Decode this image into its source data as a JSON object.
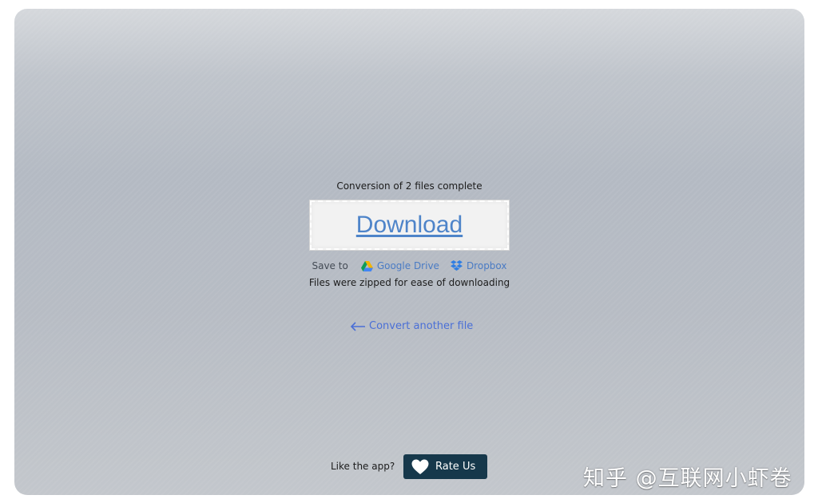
{
  "status": {
    "conversion_text": "Conversion of 2 files complete"
  },
  "download": {
    "label": "Download"
  },
  "save_to": {
    "label": "Save to",
    "services": [
      {
        "name": "Google Drive",
        "icon": "google-drive-icon"
      },
      {
        "name": "Dropbox",
        "icon": "dropbox-icon"
      }
    ]
  },
  "note": "Files were zipped for ease of downloading",
  "convert_another": {
    "label": "Convert another file",
    "icon": "arrow-left-icon"
  },
  "footer": {
    "like_text": "Like the app?",
    "rate_label": "Rate Us",
    "rate_icon": "heart-icon"
  },
  "watermark": "知乎 @互联网小虾卷",
  "colors": {
    "link": "#4a7bc4",
    "download_link": "#4e84c9",
    "rate_button": "#16384b"
  }
}
